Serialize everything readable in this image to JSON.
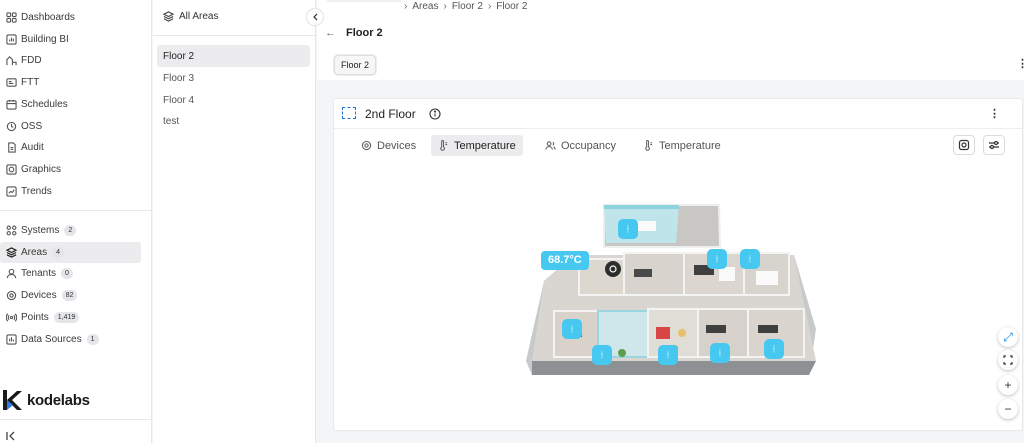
{
  "nav": {
    "items": [
      {
        "label": "Dashboards",
        "icon": "dashboard-icon"
      },
      {
        "label": "Building BI",
        "icon": "building-bi-icon"
      },
      {
        "label": "FDD",
        "icon": "fdd-icon"
      },
      {
        "label": "FTT",
        "icon": "ftt-icon"
      },
      {
        "label": "Schedules",
        "icon": "schedule-icon"
      },
      {
        "label": "OSS",
        "icon": "oss-icon"
      },
      {
        "label": "Audit",
        "icon": "audit-icon"
      },
      {
        "label": "Graphics",
        "icon": "graphics-icon"
      },
      {
        "label": "Trends",
        "icon": "trends-icon"
      }
    ],
    "secondary": [
      {
        "label": "Systems",
        "badge": "2"
      },
      {
        "label": "Areas",
        "badge": "4"
      },
      {
        "label": "Tenants",
        "badge": "0"
      },
      {
        "label": "Devices",
        "badge": "82"
      },
      {
        "label": "Points",
        "badge": "1,419"
      },
      {
        "label": "Data Sources",
        "badge": "1"
      }
    ],
    "brand": "kodelabs"
  },
  "areas_panel": {
    "header": "All Areas",
    "items": [
      "Floor 2",
      "Floor 3",
      "Floor 4",
      "test"
    ]
  },
  "breadcrumb": [
    "Areas",
    "Floor 2",
    "Floor 2"
  ],
  "page": {
    "title": "Floor 2",
    "tab": "Floor 2"
  },
  "card": {
    "title": "2nd Floor",
    "view_tabs": [
      "Devices",
      "Temperature",
      "Occupancy",
      "Temperature"
    ],
    "temperature_badge": "68.7°C"
  },
  "colors": {
    "accent": "#1e6fd9",
    "sensor": "#46c8f0"
  }
}
